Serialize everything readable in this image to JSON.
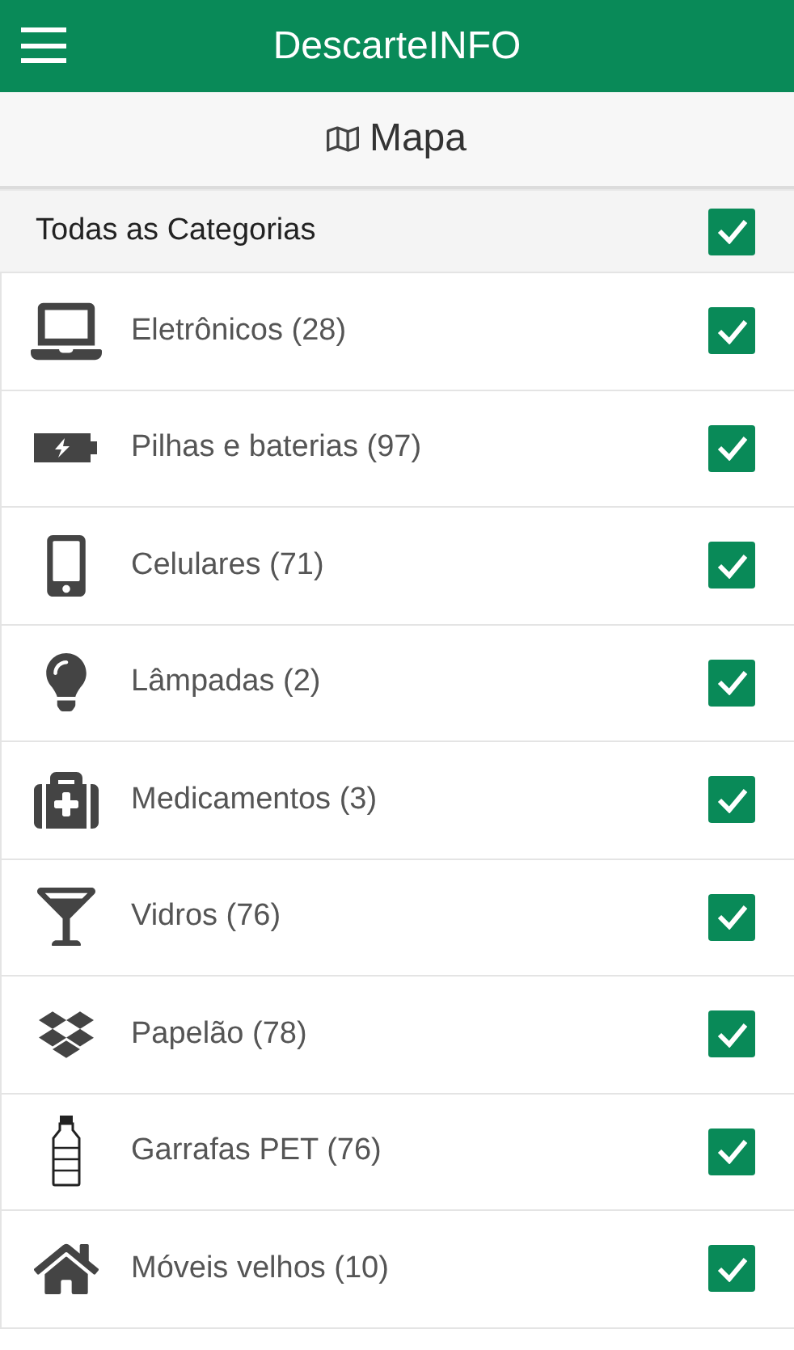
{
  "app_bar": {
    "title": "DescarteINFO"
  },
  "page_header": {
    "title": "Mapa"
  },
  "all_categories": {
    "label": "Todas as Categorias",
    "checked": true
  },
  "categories": [
    {
      "label": "Eletrônicos (28)",
      "checked": true
    },
    {
      "label": "Pilhas e baterias (97)",
      "checked": true
    },
    {
      "label": "Celulares (71)",
      "checked": true
    },
    {
      "label": "Lâmpadas (2)",
      "checked": true
    },
    {
      "label": "Medicamentos (3)",
      "checked": true
    },
    {
      "label": "Vidros (76)",
      "checked": true
    },
    {
      "label": "Papelão (78)",
      "checked": true
    },
    {
      "label": "Garrafas PET (76)",
      "checked": true
    },
    {
      "label": "Móveis velhos (10)",
      "checked": true
    }
  ]
}
